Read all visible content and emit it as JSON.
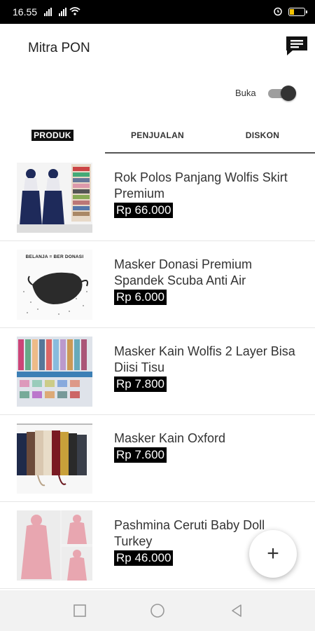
{
  "status_bar": {
    "time": "16.55"
  },
  "app": {
    "title": "Mitra PON"
  },
  "store_toggle": {
    "label": "Buka",
    "on": true
  },
  "tabs": [
    {
      "label": "PRODUK",
      "active": true
    },
    {
      "label": "PENJUALAN",
      "active": false
    },
    {
      "label": "DISKON",
      "active": false
    }
  ],
  "products": [
    {
      "name": "Rok Polos Panjang Wolfis Skirt Premium",
      "price": "Rp 66.000"
    },
    {
      "name": "Masker Donasi Premium Spandek Scuba Anti Air",
      "price": "Rp 6.000",
      "image_caption": "BELANJA = BER DONASI"
    },
    {
      "name": "Masker Kain Wolfis 2 Layer Bisa Diisi Tisu",
      "price": "Rp 7.800"
    },
    {
      "name": "Masker Kain Oxford",
      "price": "Rp 7.600"
    },
    {
      "name": "Pashmina Ceruti Baby Doll Turkey",
      "price": "Rp 46.000"
    }
  ],
  "fab": {
    "icon": "plus-icon",
    "symbol": "+"
  },
  "colors": {
    "accent": "#000000",
    "toggle_knob": "#333333",
    "battery": "#f5c400"
  },
  "navigation_bar": [
    "square-icon",
    "circle-icon",
    "back-triangle-icon"
  ]
}
